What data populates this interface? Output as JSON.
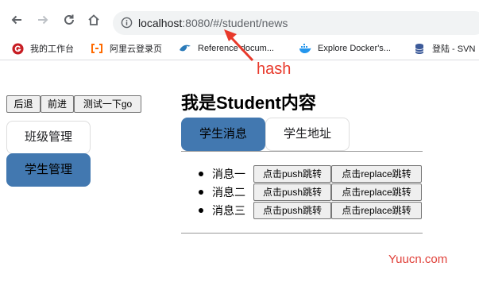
{
  "browser": {
    "url_host": "localhost",
    "url_path": ":8080/#/student/news",
    "bookmarks": [
      {
        "label": "我的工作台",
        "icon": "g-icon"
      },
      {
        "label": "阿里云登录页",
        "icon": "aliyun-icon"
      },
      {
        "label": "Reference docum...",
        "icon": "bird-icon"
      },
      {
        "label": "Explore Docker's...",
        "icon": "docker-icon"
      },
      {
        "label": "登陆 - SVN",
        "icon": "database-icon"
      }
    ]
  },
  "annotation": {
    "label": "hash",
    "color": "#e8392b"
  },
  "controls": {
    "back_label": "后退",
    "forward_label": "前进",
    "test_label": "测试一下go"
  },
  "sidebar": {
    "items": [
      {
        "label": "班级管理",
        "active": false
      },
      {
        "label": "学生管理",
        "active": true
      }
    ]
  },
  "main": {
    "title": "我是Student内容",
    "tabs": [
      {
        "label": "学生消息",
        "active": true
      },
      {
        "label": "学生地址",
        "active": false
      }
    ],
    "news": [
      {
        "text": "消息一",
        "push_label": "点击push跳转",
        "replace_label": "点击replace跳转"
      },
      {
        "text": "消息二",
        "push_label": "点击push跳转",
        "replace_label": "点击replace跳转"
      },
      {
        "text": "消息三",
        "push_label": "点击push跳转",
        "replace_label": "点击replace跳转"
      }
    ]
  },
  "watermark": "Yuucn.com",
  "colors": {
    "accent": "#4278b0",
    "annotation": "#e8392b"
  }
}
